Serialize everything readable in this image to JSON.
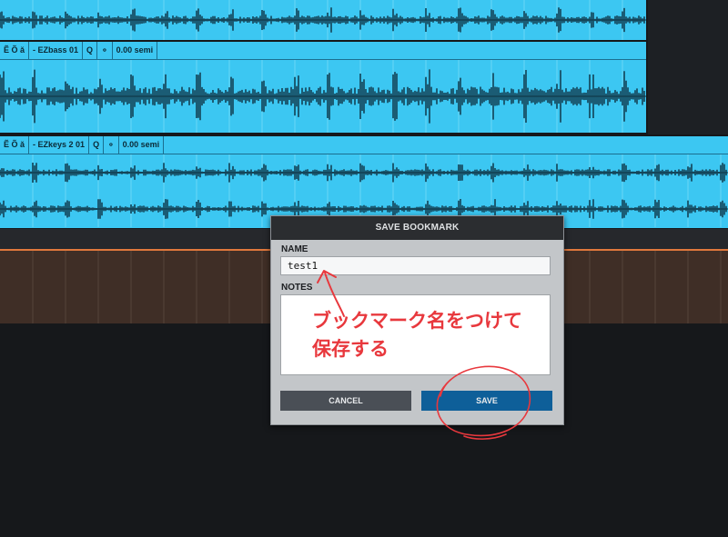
{
  "tracks": [
    {
      "header_name": "",
      "semi": ""
    },
    {
      "header_symbols": "Ẽ Õ ǎ",
      "header_name": "- EZbass 01",
      "q": "Q",
      "tune_icon": "tuning-fork-icon",
      "semi": "0.00 semi"
    },
    {
      "header_symbols": "Ẽ Õ ǎ",
      "header_name": "- EZkeys 2 01",
      "q": "Q",
      "tune_icon": "tuning-fork-icon",
      "semi": "0.00 semi"
    }
  ],
  "dialog": {
    "title": "SAVE BOOKMARK",
    "name_label": "NAME",
    "name_value": "test1",
    "notes_label": "NOTES",
    "notes_value": "",
    "cancel_label": "CANCEL",
    "save_label": "SAVE"
  },
  "annotation": {
    "text": "ブックマーク名をつけて\n保存する",
    "color": "#e8383d"
  },
  "colors": {
    "clip": "#3cc7f2",
    "waveform": "#0d2f3f",
    "track_brown": "#3f2e26",
    "playhead": "#e0783c",
    "save_button": "#0e5f99",
    "cancel_button": "#4a4f56"
  }
}
